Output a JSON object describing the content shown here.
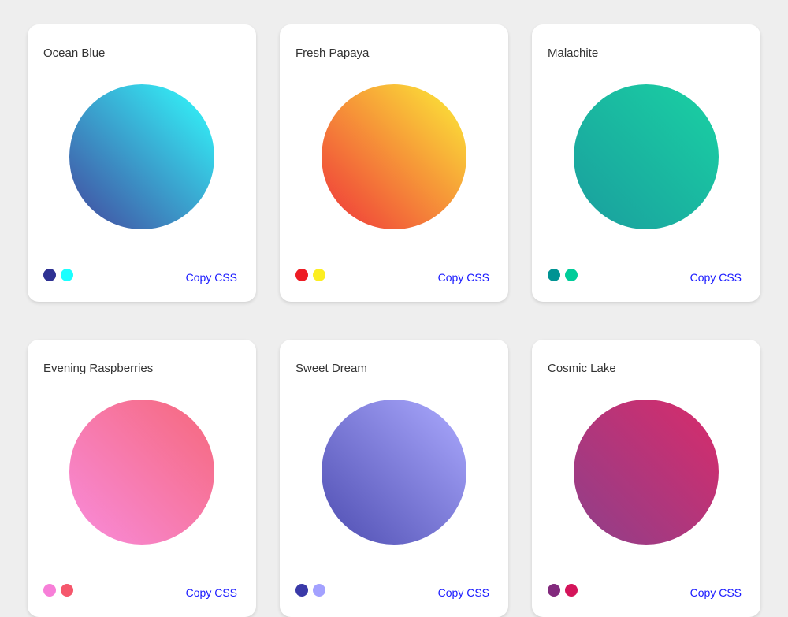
{
  "cards": [
    {
      "name": "Ocean Blue",
      "from": "#2E3192",
      "to": "#1BFFFF",
      "copy": "Copy CSS"
    },
    {
      "name": "Fresh Papaya",
      "from": "#ED1C24",
      "to": "#FCEE21",
      "copy": "Copy CSS"
    },
    {
      "name": "Malachite",
      "from": "#009393",
      "to": "#00CC99",
      "copy": "Copy CSS"
    },
    {
      "name": "Evening Raspberries",
      "from": "#F77FD8",
      "to": "#F5576C",
      "copy": "Copy CSS"
    },
    {
      "name": "Sweet Dream",
      "from": "#3A39A8",
      "to": "#A3A1FF",
      "copy": "Copy CSS"
    },
    {
      "name": "Cosmic Lake",
      "from": "#822A7D",
      "to": "#D4145A",
      "copy": "Copy CSS"
    }
  ]
}
